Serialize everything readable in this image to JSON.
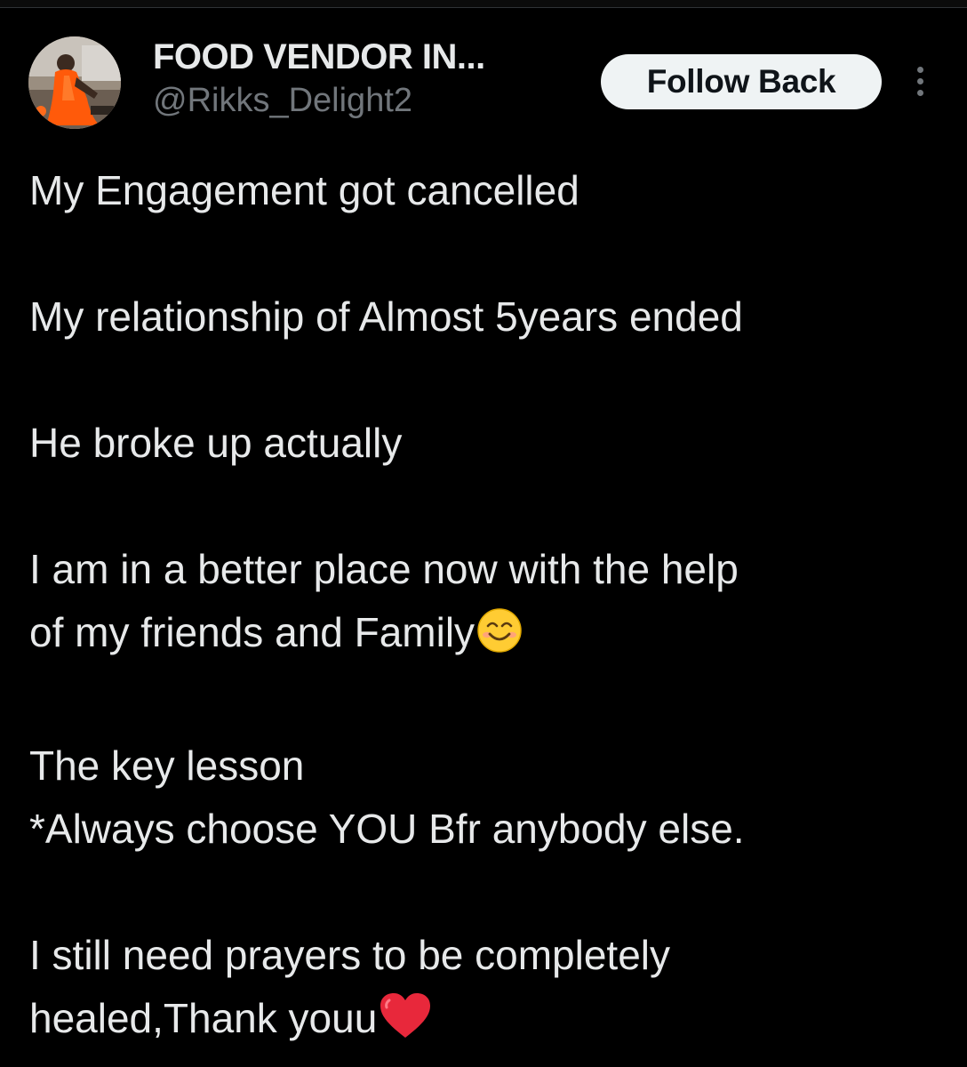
{
  "post": {
    "author": {
      "display_name": "FOOD VENDOR IN...",
      "handle": "@Rikks_Delight2",
      "avatar_icon": "avatar-photo"
    },
    "actions": {
      "follow_label": "Follow Back",
      "more_icon": "more-vertical-icon"
    },
    "lines": {
      "l1": "My Engagement got cancelled",
      "l2": "My relationship of Almost 5years ended",
      "l3": "He broke up actually",
      "l4a": "I am in a better place now with the help",
      "l4b": "of my friends and Family",
      "l5a": "The key lesson",
      "l5b": "*Always choose YOU Bfr anybody else.",
      "l6a": "I still need prayers to be completely",
      "l6b": "healed,Thank youu"
    },
    "emojis": {
      "smile": "smiling-face-emoji",
      "heart": "red-heart-emoji"
    }
  },
  "colors": {
    "background": "#000000",
    "text_primary": "#e7e9ea",
    "text_secondary": "#71767b",
    "button_bg": "#eff3f4",
    "button_text": "#0f1419",
    "heart": "#e8283b",
    "emoji_face": "#ffcc33"
  }
}
